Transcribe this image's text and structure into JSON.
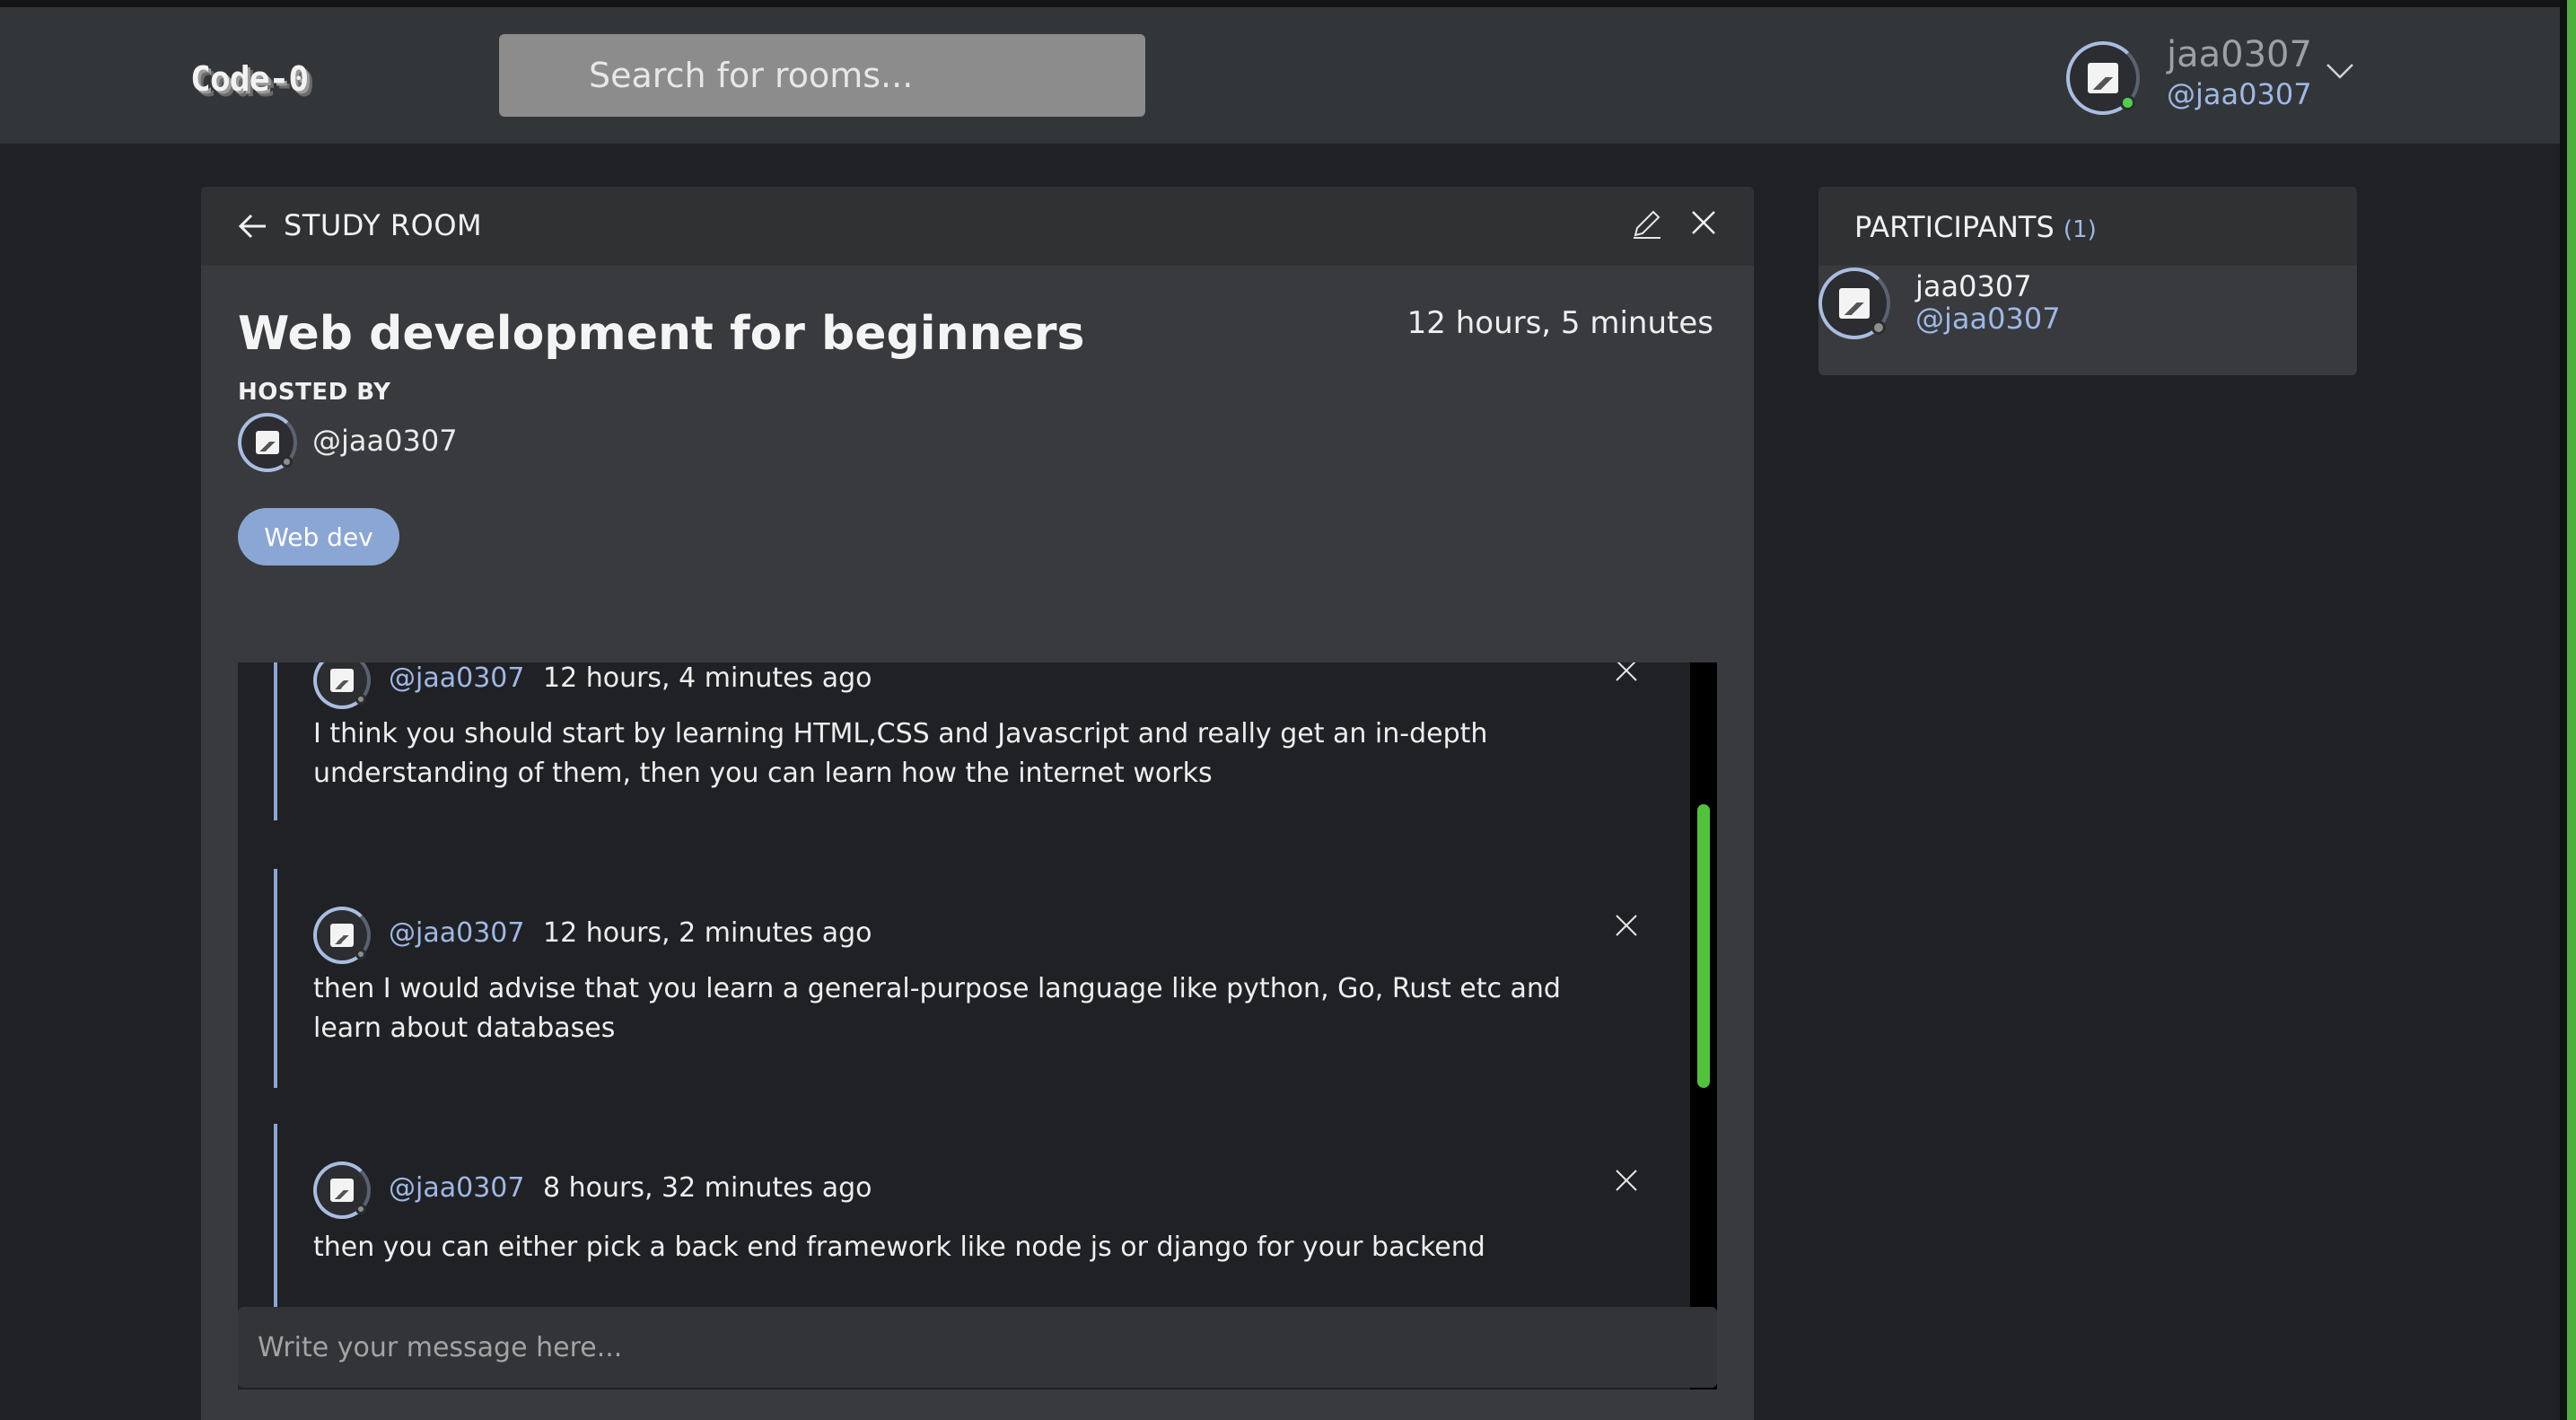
{
  "app": {
    "logo": "Code-0",
    "search_placeholder": "Search for rooms..."
  },
  "current_user": {
    "name": "jaa0307",
    "handle": "@jaa0307",
    "status": "online"
  },
  "room": {
    "section_label": "STUDY ROOM",
    "title": "Web development for beginners",
    "created": "12 hours, 5 minutes",
    "hosted_by_label": "HOSTED BY",
    "host_handle": "@jaa0307",
    "topic_tag": "Web dev",
    "composer_placeholder": "Write your message here...",
    "messages": [
      {
        "handle": "@jaa0307",
        "time": "12 hours, 4 minutes ago",
        "body": "I think you should start by learning HTML,CSS and Javascript and really get an in-depth understanding of them, then you can learn how the internet works"
      },
      {
        "handle": "@jaa0307",
        "time": "12 hours, 2 minutes ago",
        "body": "then I would advise that you learn a general-purpose language like python, Go, Rust etc and learn about databases"
      },
      {
        "handle": "@jaa0307",
        "time": "8 hours, 32 minutes ago",
        "body": "then you can either pick a back end framework like node js or django for your backend"
      }
    ]
  },
  "participants": {
    "title": "PARTICIPANTS",
    "count": "(1)",
    "items": [
      {
        "name": "jaa0307",
        "handle": "@jaa0307",
        "status": "offline"
      }
    ]
  },
  "colors": {
    "accent_blue": "#8aa6d4",
    "handle_blue": "#9eb8e6",
    "online_green": "#4fcf4b",
    "scrollbar_green": "#53c23b"
  }
}
